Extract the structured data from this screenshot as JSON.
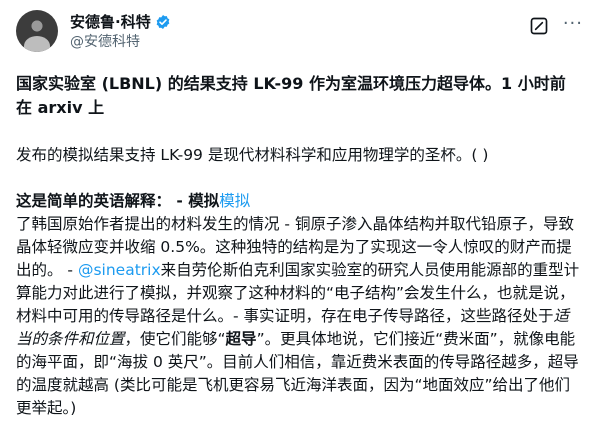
{
  "author": {
    "name": "安德鲁·科特",
    "handle": "@安德科特",
    "verified": true,
    "icons": [
      "avatar",
      "verified-badge-icon",
      "grok-icon",
      "more-options-icon"
    ],
    "accent_color": "#1d9bf0"
  },
  "more_label": "···",
  "tweet": {
    "headline": "国家实验室 (LBNL) 的结果支持 LK-99 作为室温环境压力超导体。1 小时前在 arxiv 上",
    "subline": "发布的模拟结果支持 LK-99 是现代材料科学和应用物理学的圣杯。( )",
    "p3": {
      "title": "这是简单的英语解释：",
      "title_sep": " - ",
      "title_sim": "模拟",
      "title_sim_link": "模拟",
      "s1": "了韩国原始作者提出的材料发生的情况 - 铜原子渗入晶体结构并取代铅原子，导致晶体轻微应变并收缩 0.5%。这种独特的结构是为了实现这一令人惊叹的财产而提出的。 - ",
      "mention": "@sineatrix",
      "s2": "来自劳伦斯伯克利国家实验室的研究人员使用能源部的重型计算能力对此进行了模拟，并观察了这种材料的“电子结构”会发生什么，也就是说，材料中可用的传导路径是什么。- 事实证明，存在电子传导路径，这些路径处于",
      "emph": "适当的条件和位置",
      "s3": "，使它们能够“",
      "bold_word": "超导",
      "s4": "”。更具体地说，它们接近“费米面”，就像电能的海平面，即“海拔 0 英尺”。目前人们相信，靠近费米表面的传导路径越多，超导的温度就越高 (类比可能是飞机更容易飞近海洋表面，因为“地面效应”给出了他们更举起。)"
    }
  }
}
